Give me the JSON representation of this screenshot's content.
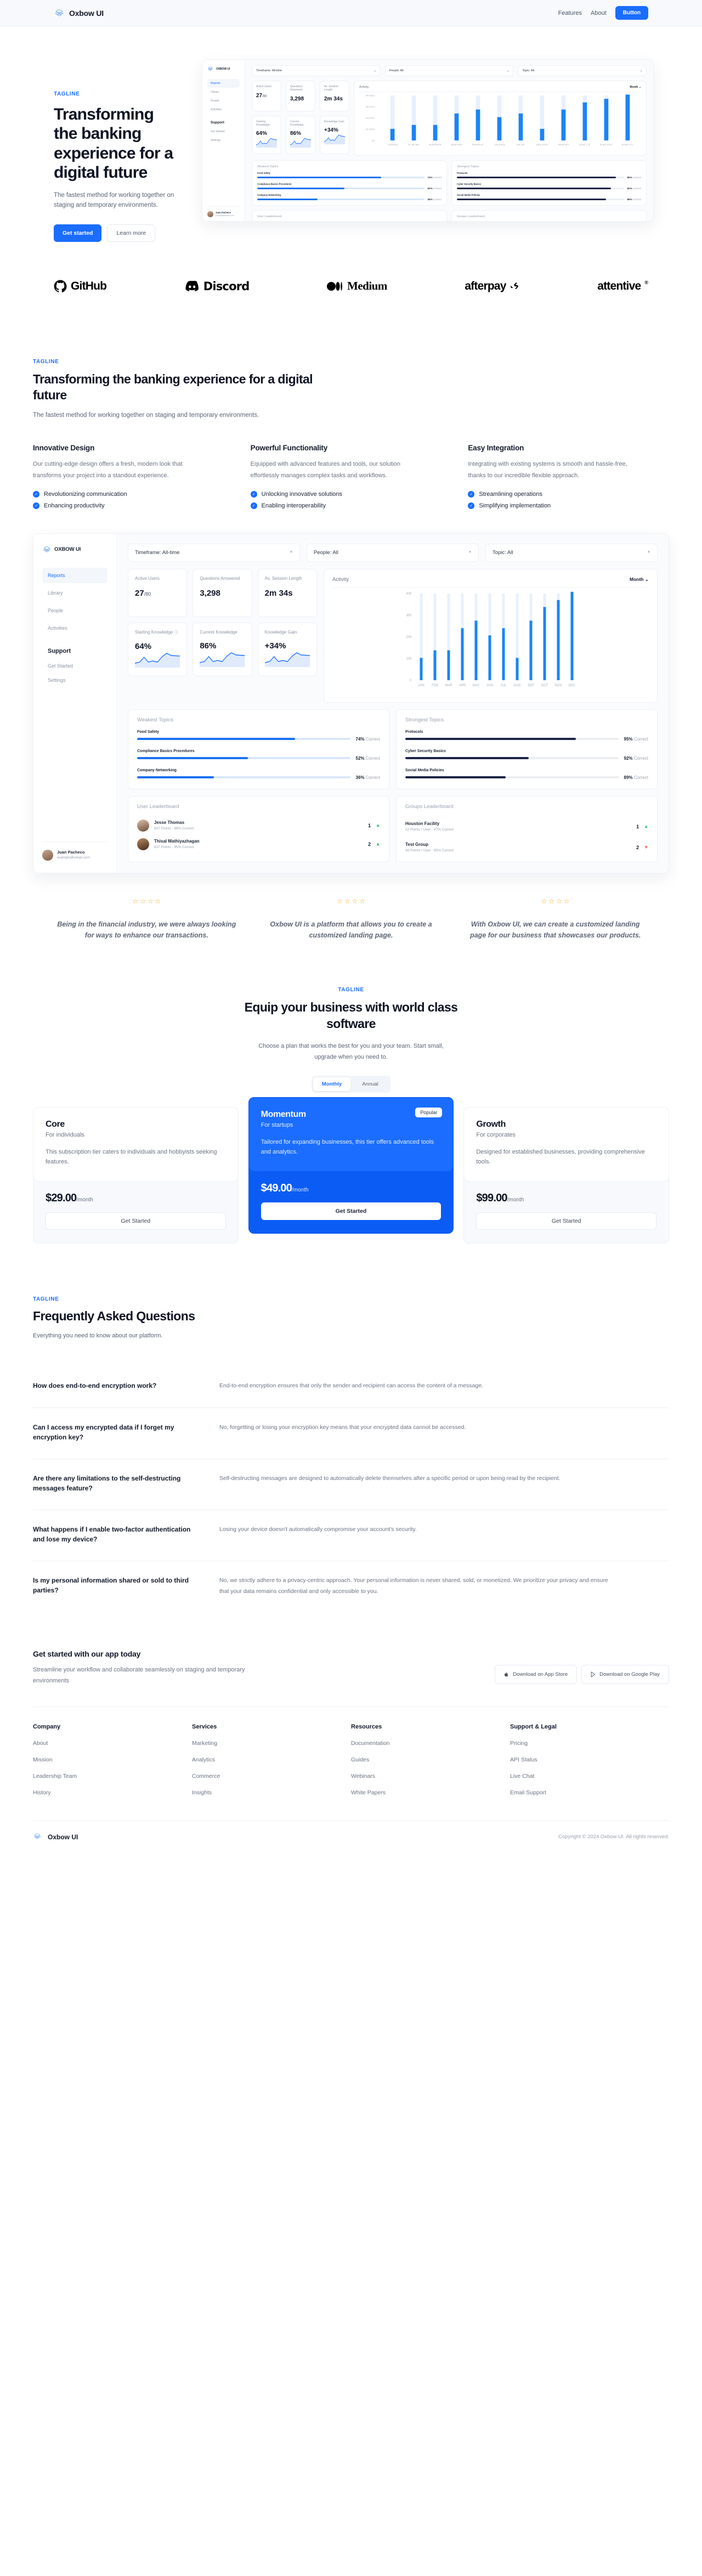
{
  "brand": {
    "name": "Oxbow UI",
    "accent": "#1a6dff"
  },
  "nav": {
    "links": [
      {
        "label": "Features"
      },
      {
        "label": "About"
      }
    ],
    "button": "Button"
  },
  "hero": {
    "tagline": "TAGLINE",
    "title": "Transforming the banking experience for a digital future",
    "subtitle": "The fastest method for working together on staging and temporary environments.",
    "primary_cta": "Get started",
    "secondary_cta": "Learn more"
  },
  "dashboard": {
    "logo_text": "OXBOW UI",
    "nav": [
      "Reports",
      "Library",
      "People",
      "Activities"
    ],
    "support_heading": "Support",
    "support_items": [
      "Get Started",
      "Settings"
    ],
    "filters": [
      {
        "label": "Timeframe: All-time"
      },
      {
        "label": "People: All"
      },
      {
        "label": "Topic: All"
      }
    ],
    "kpis": [
      {
        "label": "Active Users",
        "value": "27",
        "suffix": "/80"
      },
      {
        "label": "Questions Answered",
        "value": "3,298",
        "suffix": ""
      },
      {
        "label": "Av. Session Length",
        "value": "2m 34s",
        "suffix": ""
      }
    ],
    "kpis2": [
      {
        "label": "Starting Knowledge",
        "value": "64%"
      },
      {
        "label": "Current Knowledge",
        "value": "86%"
      },
      {
        "label": "Knowledge Gain",
        "value": "+34%"
      }
    ],
    "activity_title": "Activity",
    "activity_period": "Month",
    "weakest_title": "Weakest Topics",
    "weakest": [
      {
        "name": "Food Safety",
        "pct": "74%",
        "correct": "Correct",
        "value": 74
      },
      {
        "name": "Compliance Basics Procedures",
        "pct": "52%",
        "correct": "Correct",
        "value": 52
      },
      {
        "name": "Company Networking",
        "pct": "36%",
        "correct": "Correct",
        "value": 36
      }
    ],
    "strongest_title": "Strongest Topics",
    "strongest": [
      {
        "name": "Protocols",
        "pct": "95%",
        "correct": "Correct",
        "value": 95
      },
      {
        "name": "Cyber Security Basics",
        "pct": "92%",
        "correct": "Correct",
        "value": 92
      },
      {
        "name": "Social Media Policies",
        "pct": "89%",
        "correct": "Correct",
        "value": 89
      }
    ],
    "user_leaderboard_title": "User Leaderboard",
    "users": [
      {
        "name": "Jesse Thomas",
        "meta": "637 Points - 98% Correct",
        "rank": "1",
        "dir": "up"
      },
      {
        "name": "Thisal Mathiyazhagan",
        "meta": "637 Points - 95% Correct",
        "rank": "2",
        "dir": "up"
      }
    ],
    "groups_leaderboard_title": "Groups Leaderboard",
    "groups": [
      {
        "name": "Houston Facility",
        "meta": "52 Points / User - 97% Correct",
        "rank": "1",
        "dir": "up"
      },
      {
        "name": "Test Group",
        "meta": "48 Points / User - 95% Correct",
        "rank": "2",
        "dir": "down"
      }
    ],
    "account": {
      "name": "Juan Pacheco",
      "email": "example@email.com"
    }
  },
  "chart_data": {
    "type": "bar",
    "title": "Activity",
    "xlabel": "",
    "ylabel": "",
    "ylim": [
      0,
      400
    ],
    "yticks": [
      0,
      100,
      200,
      300,
      400
    ],
    "grid": false,
    "legend": null,
    "categories": [
      "JAN",
      "FEB",
      "MAR",
      "APR",
      "MAY",
      "JUN",
      "JUL",
      "AUG",
      "SEP",
      "OCT",
      "NOV",
      "DEC"
    ],
    "values": [
      103,
      138,
      138,
      240,
      275,
      207,
      240,
      103,
      275,
      338,
      370,
      408
    ]
  },
  "logos": [
    {
      "name": "GitHub",
      "icon": "github-icon"
    },
    {
      "name": "Discord",
      "icon": "discord-icon"
    },
    {
      "name": "Medium",
      "icon": "medium-icon"
    },
    {
      "name": "afterpay",
      "icon": "afterpay-icon"
    },
    {
      "name": "attentive",
      "icon": "attentive-icon"
    }
  ],
  "features": {
    "tagline": "TAGLINE",
    "title": "Transforming the banking experience for a digital future",
    "lead": "The fastest method for working together on staging and temporary environments.",
    "items": [
      {
        "title": "Innovative Design",
        "body": "Our cutting-edge design offers a fresh, modern look that transforms your project into a standout experience.",
        "checks": [
          "Revolutionizing communication",
          "Enhancing productivity"
        ]
      },
      {
        "title": "Powerful Functionality",
        "body": "Equipped with advanced features and tools, our solution effortlessly manages complex tasks and workflows.",
        "checks": [
          "Unlocking innovative solutions",
          "Enabling interoperability"
        ]
      },
      {
        "title": "Easy Integration",
        "body": "Integrating with existing systems is smooth and hassle-free, thanks to our incredible flexible approach.",
        "checks": [
          "Streamlining operations",
          "Simplifying implementation"
        ]
      }
    ]
  },
  "testimonials": [
    {
      "stars": 4,
      "quote": "Being in the financial industry, we were always looking for ways to enhance our transactions."
    },
    {
      "stars": 4,
      "quote": "Oxbow UI is a platform that allows you to create a customized landing page."
    },
    {
      "stars": 4,
      "quote": "With Oxbow UI, we can create a customized landing page for our business that showcases our products."
    }
  ],
  "pricing": {
    "tagline": "TAGLINE",
    "title": "Equip your business with world class software",
    "lead": "Choose a plan that works the best for you and your team. Start small, upgrade when you need to.",
    "toggle": {
      "monthly": "Monthly",
      "annual": "Annual",
      "selected": "Monthly"
    },
    "plans": [
      {
        "name": "Core",
        "who": "For individuals",
        "desc": "This subscription tier caters to individuals and hobbyists seeking features.",
        "price": "$29.00",
        "period": "/month",
        "cta": "Get Started",
        "badge": null,
        "featured": false
      },
      {
        "name": "Momentum",
        "who": "For startups",
        "desc": "Tailored for expanding businesses, this tier offers advanced tools and analytics.",
        "price": "$49.00",
        "period": "/month",
        "cta": "Get Started",
        "badge": "Popular",
        "featured": true
      },
      {
        "name": "Growth",
        "who": "For corporates",
        "desc": "Designed for established businesses, providing comprehensive tools.",
        "price": "$99.00",
        "period": "/month",
        "cta": "Get Started",
        "badge": null,
        "featured": false
      }
    ]
  },
  "faq": {
    "tagline": "TAGLINE",
    "title": "Frequently Asked Questions",
    "lead": "Everything you need to know about our platform.",
    "items": [
      {
        "q": "How does end-to-end encryption work?",
        "a": "End-to-end encryption ensures that only the sender and recipient can access the content of a message."
      },
      {
        "q": "Can I access my encrypted data if I forget my encryption key?",
        "a": "No, forgetting or losing your encryption key means that your encrypted data cannot be accessed."
      },
      {
        "q": "Are there any limitations to the self-destructing messages feature?",
        "a": "Self-destructing messages are designed to automatically delete themselves after a specific period or upon being read by the recipient."
      },
      {
        "q": "What happens if I enable two-factor authentication and lose my device?",
        "a": "Losing your device doesn't automatically compromise your account's security."
      },
      {
        "q": "Is my personal information shared or sold to third parties?",
        "a": "No, we strictly adhere to a privacy-centric approach. Your personal information is never shared, sold, or monetized. We prioritize your privacy and ensure that your data remains confidential and only accessible to you."
      }
    ]
  },
  "cta": {
    "title": "Get started with our app today",
    "body": "Streamline your workflow and collaborate seamlessly on staging and temporary environments",
    "app_store": "Download on App Store",
    "google_play": "Download on Google Play"
  },
  "footer": {
    "columns": [
      {
        "title": "Company",
        "links": [
          "About",
          "Mission",
          "Leadership Team",
          "History"
        ]
      },
      {
        "title": "Services",
        "links": [
          "Marketing",
          "Analytics",
          "Commerce",
          "Insights"
        ]
      },
      {
        "title": "Resources",
        "links": [
          "Documentation",
          "Guides",
          "Webinars",
          "White Papers"
        ]
      },
      {
        "title": "Support & Legal",
        "links": [
          "Pricing",
          "API Status",
          "Live Chat",
          "Email Support"
        ]
      }
    ],
    "brand": "Oxbow UI",
    "copyright": "Copyright © 2024 Oxbow UI. All rights reserved."
  }
}
